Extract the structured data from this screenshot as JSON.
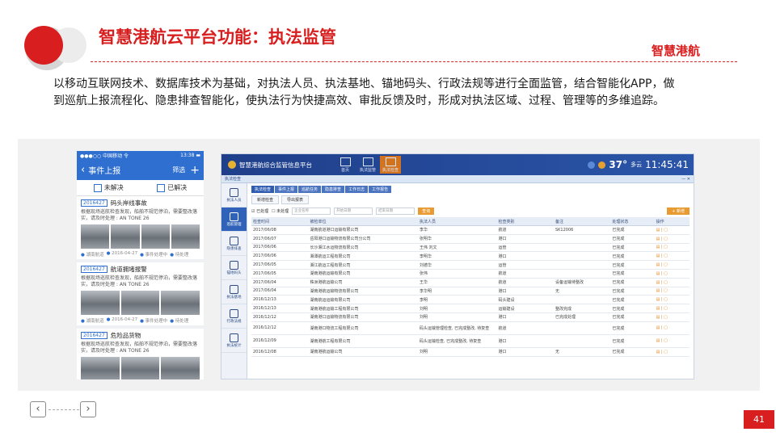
{
  "slide": {
    "title": "智慧港航云平台功能：执法监管",
    "brand": "智慧港航",
    "intro": "以移动互联网技术、数据库技术为基础，对执法人员、执法基地、锚地码头、行政法规等进行全面监管，结合智能化APP，做到巡航上报流程化、隐患排查智能化，使执法行为快捷高效、审批反馈及时，形成对执法区域、过程、管理等的多维追踪。",
    "page_number": "41",
    "prev_icon": "‹",
    "next_icon": "›",
    "colors": {
      "accent": "#d81e1e",
      "app_blue": "#2f6fd0",
      "desk_header": "#1f3f8a",
      "orange": "#e89b33"
    }
  },
  "mobile": {
    "status_left": "●●●○○ 中国移动 令",
    "status_right": "13:38 ▬",
    "nav_back": "‹",
    "nav_title": "事件上报",
    "nav_action": "筛选",
    "nav_plus": "+",
    "tabs": [
      "未解决",
      "已解决"
    ],
    "cards": [
      {
        "tag": "2016427",
        "title": "码头岸线事故",
        "desc": "根据现场巡航检查发现，船舶不规范停泊，需要整改落实，请及时处理 : AN TONE 26",
        "images": 4,
        "footer": [
          "湖南航道",
          "2016-04-27",
          "事件处理中",
          "待处理"
        ]
      },
      {
        "tag": "2016427",
        "title": "航道拥堵报警",
        "desc": "根据现场巡航检查发现，船舶不规范停泊，需要整改落实，请及时处理 : AN TONE 26",
        "images": 3,
        "footer": [
          "湖南航道",
          "2016-04-27",
          "事件处理中",
          "待处理"
        ]
      },
      {
        "tag": "2016427",
        "title": "危险品货物",
        "desc": "根据现场巡航检查发现，船舶不规范停泊，需要整改落实，请及时处理 : AN TONE 26",
        "images": 3,
        "footer": []
      }
    ]
  },
  "desktop": {
    "system_title": "智慧港航综合监管信息平台",
    "modules": [
      {
        "label": "首页",
        "active": false
      },
      {
        "label": "执法监管",
        "active": false
      },
      {
        "label": "执法检查",
        "active": true
      }
    ],
    "temperature": "37°",
    "weather": "多云",
    "time": "11:45:41",
    "subbar_left": "执法检查",
    "subbar_right": "— ✕",
    "sidebar": [
      "执法人员",
      "巡航管理",
      "隐患排查",
      "锚地码头",
      "执法基地",
      "行政法规",
      "执法统计"
    ],
    "tabs_top": [
      "执法检查",
      "事件上报",
      "巡航任务",
      "隐患排查",
      "工作日志",
      "工作报告"
    ],
    "tabs_sub": [
      "新增检查",
      "导出报表"
    ],
    "filter": {
      "check_a": "☑ 已处理",
      "check_b": "☐ 未处理",
      "inputs": [
        "企业名称",
        "开始日期",
        "结束日期"
      ],
      "search": "查询",
      "add": "+ 新增"
    },
    "table": {
      "headers": [
        "检查时间",
        "被检单位",
        "执法人员",
        "检查类别",
        "备注",
        "处理状态",
        "操作"
      ],
      "rows": [
        [
          "2017/06/08",
          "湖南航道港口运输有限公司",
          "李华",
          "航道",
          "SK12006",
          "已完成",
          "▤ | ▢"
        ],
        [
          "2017/06/07",
          "岳阳港口运输物流有限公司分公司",
          "张明华",
          "港口",
          "",
          "已完成",
          "▤ | ▢"
        ],
        [
          "2017/06/06",
          "长沙湘江水运物流有限公司",
          "王伟 刘文",
          "运管",
          "",
          "已完成",
          "▤ | ▢"
        ],
        [
          "2017/06/06",
          "湘潭航运工程有限公司",
          "李明华",
          "港口",
          "",
          "已完成",
          "▤ | ▢"
        ],
        [
          "2017/06/05",
          "湘江航运工程有限公司",
          "刘德华",
          "运管",
          "",
          "已完成",
          "▤ | ▢"
        ],
        [
          "2017/06/05",
          "湖南港航运输有限公司",
          "张伟",
          "航道",
          "",
          "已完成",
          "▤ | ▢"
        ],
        [
          "2017/06/04",
          "株洲港航运输公司",
          "王华",
          "航道",
          "设备运输待整改",
          "已完成",
          "▤ | ▢"
        ],
        [
          "2017/06/04",
          "湖南港航运输物流有限公司",
          "李华明",
          "港口",
          "无",
          "已完成",
          "▤ | ▢"
        ],
        [
          "2016/12/13",
          "湖南航运运输有限公司",
          "李明",
          "码头建设",
          "",
          "已完成",
          "▤ | ▢"
        ],
        [
          "2016/12/13",
          "湖南港航运输工程有限公司",
          "刘明",
          "运输建设",
          "整改完成",
          "已完成",
          "▤ | ▢"
        ],
        [
          "2016/12/12",
          "湖南港口运输物流有限公司",
          "刘明",
          "港口",
          "已完成处理",
          "已完成",
          "▤ | ▢"
        ],
        [
          "2016/12/12",
          "湖南港口物流工程有限公司",
          "码头运输管理检查, 已完成整改, 待复查",
          "航道",
          "",
          "已完成",
          "▤ | ▢"
        ],
        [
          "2016/12/09",
          "湖南港航工程有限公司",
          "码头运输检查, 已完成整改, 待复查",
          "港口",
          "",
          "已完成",
          "▤ | ▢"
        ],
        [
          "2016/12/08",
          "湖南港航运输公司",
          "刘明",
          "港口",
          "无",
          "已完成",
          "▤ | ▢"
        ]
      ]
    }
  }
}
